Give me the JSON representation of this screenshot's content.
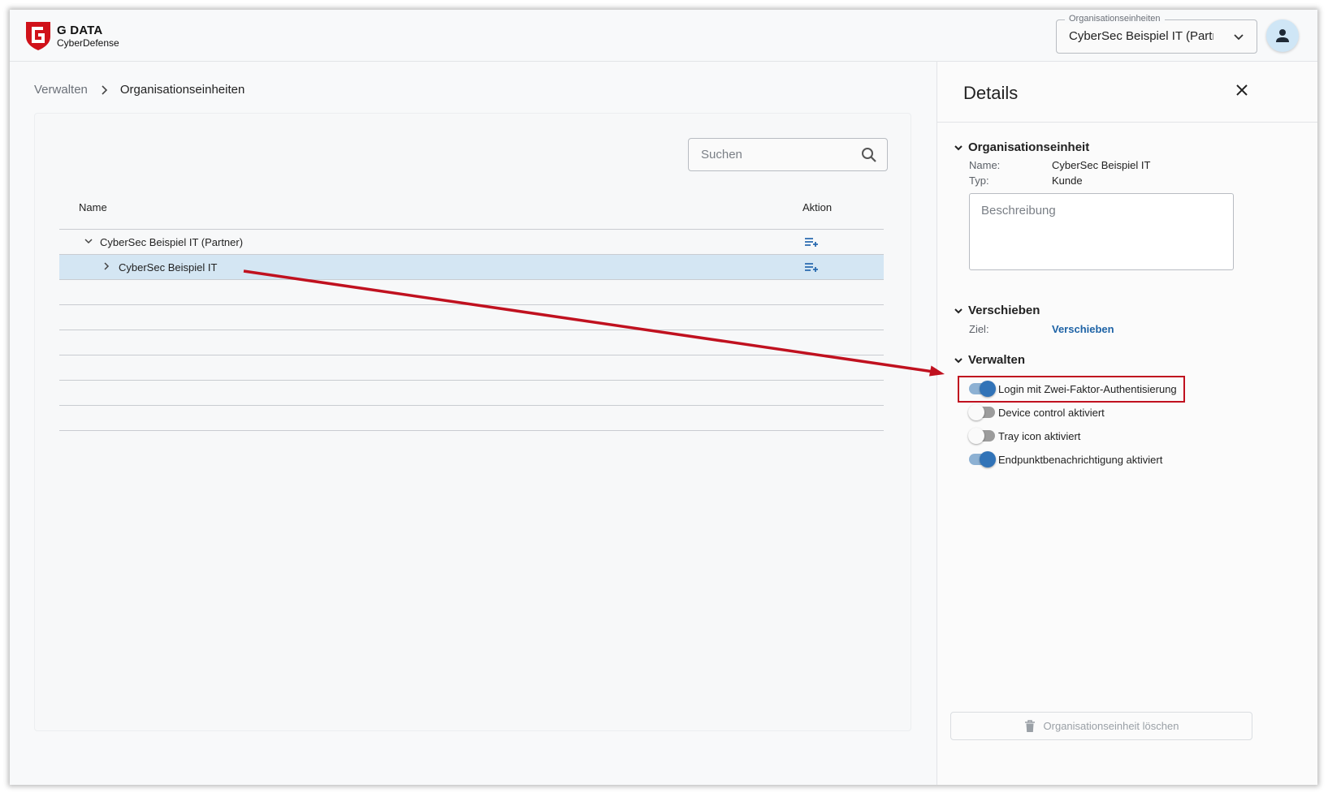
{
  "brand": {
    "name": "G DATA",
    "subtitle": "CyberDefense",
    "color": "#d0121a"
  },
  "header": {
    "org_select_label": "Organisationseinheiten",
    "org_select_value": "CyberSec Beispiel IT (Partner)"
  },
  "breadcrumb": {
    "items": [
      "Verwalten",
      "Organisationseinheiten"
    ]
  },
  "search": {
    "placeholder": "Suchen"
  },
  "table": {
    "columns": [
      "Name",
      "Aktion"
    ],
    "rows": [
      {
        "label": "CyberSec Beispiel IT (Partner)",
        "expanded": true,
        "selected": false
      },
      {
        "label": "CyberSec Beispiel IT",
        "expanded": false,
        "selected": true
      }
    ]
  },
  "details": {
    "title": "Details",
    "org_unit": {
      "heading": "Organisationseinheit",
      "name_key": "Name:",
      "name_val": "CyberSec Beispiel IT",
      "type_key": "Typ:",
      "type_val": "Kunde",
      "description_placeholder": "Beschreibung"
    },
    "move": {
      "heading": "Verschieben",
      "target_key": "Ziel:",
      "target_link": "Verschieben"
    },
    "manage": {
      "heading": "Verwalten",
      "toggles": [
        {
          "label": "Login mit Zwei-Faktor-Authentisierung",
          "on": true
        },
        {
          "label": "Device control aktiviert",
          "on": false
        },
        {
          "label": "Tray icon aktiviert",
          "on": false
        },
        {
          "label": "Endpunktbenachrichtigung aktiviert",
          "on": true
        }
      ]
    },
    "delete_label": "Organisationseinheit löschen"
  },
  "colors": {
    "accent": "#3173b7",
    "selected_row": "#d4e6f3",
    "annotation": "#c0111f",
    "link": "#1e63a6"
  }
}
